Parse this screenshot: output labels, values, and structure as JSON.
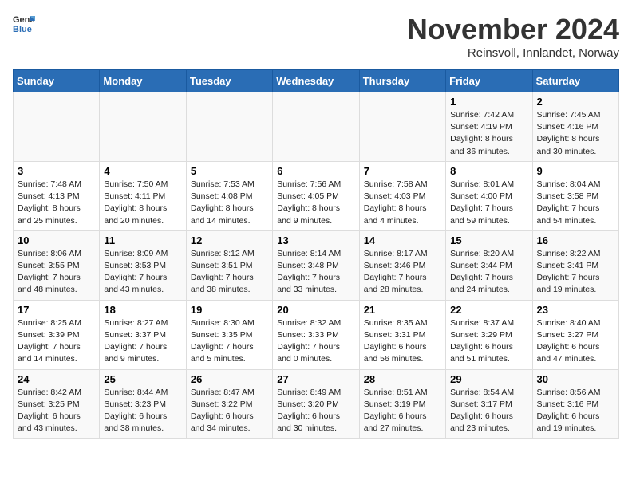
{
  "logo": {
    "general": "General",
    "blue": "Blue"
  },
  "title": "November 2024",
  "subtitle": "Reinsvoll, Innlandet, Norway",
  "days_of_week": [
    "Sunday",
    "Monday",
    "Tuesday",
    "Wednesday",
    "Thursday",
    "Friday",
    "Saturday"
  ],
  "weeks": [
    [
      {
        "day": "",
        "info": ""
      },
      {
        "day": "",
        "info": ""
      },
      {
        "day": "",
        "info": ""
      },
      {
        "day": "",
        "info": ""
      },
      {
        "day": "",
        "info": ""
      },
      {
        "day": "1",
        "info": "Sunrise: 7:42 AM\nSunset: 4:19 PM\nDaylight: 8 hours\nand 36 minutes."
      },
      {
        "day": "2",
        "info": "Sunrise: 7:45 AM\nSunset: 4:16 PM\nDaylight: 8 hours\nand 30 minutes."
      }
    ],
    [
      {
        "day": "3",
        "info": "Sunrise: 7:48 AM\nSunset: 4:13 PM\nDaylight: 8 hours\nand 25 minutes."
      },
      {
        "day": "4",
        "info": "Sunrise: 7:50 AM\nSunset: 4:11 PM\nDaylight: 8 hours\nand 20 minutes."
      },
      {
        "day": "5",
        "info": "Sunrise: 7:53 AM\nSunset: 4:08 PM\nDaylight: 8 hours\nand 14 minutes."
      },
      {
        "day": "6",
        "info": "Sunrise: 7:56 AM\nSunset: 4:05 PM\nDaylight: 8 hours\nand 9 minutes."
      },
      {
        "day": "7",
        "info": "Sunrise: 7:58 AM\nSunset: 4:03 PM\nDaylight: 8 hours\nand 4 minutes."
      },
      {
        "day": "8",
        "info": "Sunrise: 8:01 AM\nSunset: 4:00 PM\nDaylight: 7 hours\nand 59 minutes."
      },
      {
        "day": "9",
        "info": "Sunrise: 8:04 AM\nSunset: 3:58 PM\nDaylight: 7 hours\nand 54 minutes."
      }
    ],
    [
      {
        "day": "10",
        "info": "Sunrise: 8:06 AM\nSunset: 3:55 PM\nDaylight: 7 hours\nand 48 minutes."
      },
      {
        "day": "11",
        "info": "Sunrise: 8:09 AM\nSunset: 3:53 PM\nDaylight: 7 hours\nand 43 minutes."
      },
      {
        "day": "12",
        "info": "Sunrise: 8:12 AM\nSunset: 3:51 PM\nDaylight: 7 hours\nand 38 minutes."
      },
      {
        "day": "13",
        "info": "Sunrise: 8:14 AM\nSunset: 3:48 PM\nDaylight: 7 hours\nand 33 minutes."
      },
      {
        "day": "14",
        "info": "Sunrise: 8:17 AM\nSunset: 3:46 PM\nDaylight: 7 hours\nand 28 minutes."
      },
      {
        "day": "15",
        "info": "Sunrise: 8:20 AM\nSunset: 3:44 PM\nDaylight: 7 hours\nand 24 minutes."
      },
      {
        "day": "16",
        "info": "Sunrise: 8:22 AM\nSunset: 3:41 PM\nDaylight: 7 hours\nand 19 minutes."
      }
    ],
    [
      {
        "day": "17",
        "info": "Sunrise: 8:25 AM\nSunset: 3:39 PM\nDaylight: 7 hours\nand 14 minutes."
      },
      {
        "day": "18",
        "info": "Sunrise: 8:27 AM\nSunset: 3:37 PM\nDaylight: 7 hours\nand 9 minutes."
      },
      {
        "day": "19",
        "info": "Sunrise: 8:30 AM\nSunset: 3:35 PM\nDaylight: 7 hours\nand 5 minutes."
      },
      {
        "day": "20",
        "info": "Sunrise: 8:32 AM\nSunset: 3:33 PM\nDaylight: 7 hours\nand 0 minutes."
      },
      {
        "day": "21",
        "info": "Sunrise: 8:35 AM\nSunset: 3:31 PM\nDaylight: 6 hours\nand 56 minutes."
      },
      {
        "day": "22",
        "info": "Sunrise: 8:37 AM\nSunset: 3:29 PM\nDaylight: 6 hours\nand 51 minutes."
      },
      {
        "day": "23",
        "info": "Sunrise: 8:40 AM\nSunset: 3:27 PM\nDaylight: 6 hours\nand 47 minutes."
      }
    ],
    [
      {
        "day": "24",
        "info": "Sunrise: 8:42 AM\nSunset: 3:25 PM\nDaylight: 6 hours\nand 43 minutes."
      },
      {
        "day": "25",
        "info": "Sunrise: 8:44 AM\nSunset: 3:23 PM\nDaylight: 6 hours\nand 38 minutes."
      },
      {
        "day": "26",
        "info": "Sunrise: 8:47 AM\nSunset: 3:22 PM\nDaylight: 6 hours\nand 34 minutes."
      },
      {
        "day": "27",
        "info": "Sunrise: 8:49 AM\nSunset: 3:20 PM\nDaylight: 6 hours\nand 30 minutes."
      },
      {
        "day": "28",
        "info": "Sunrise: 8:51 AM\nSunset: 3:19 PM\nDaylight: 6 hours\nand 27 minutes."
      },
      {
        "day": "29",
        "info": "Sunrise: 8:54 AM\nSunset: 3:17 PM\nDaylight: 6 hours\nand 23 minutes."
      },
      {
        "day": "30",
        "info": "Sunrise: 8:56 AM\nSunset: 3:16 PM\nDaylight: 6 hours\nand 19 minutes."
      }
    ]
  ]
}
